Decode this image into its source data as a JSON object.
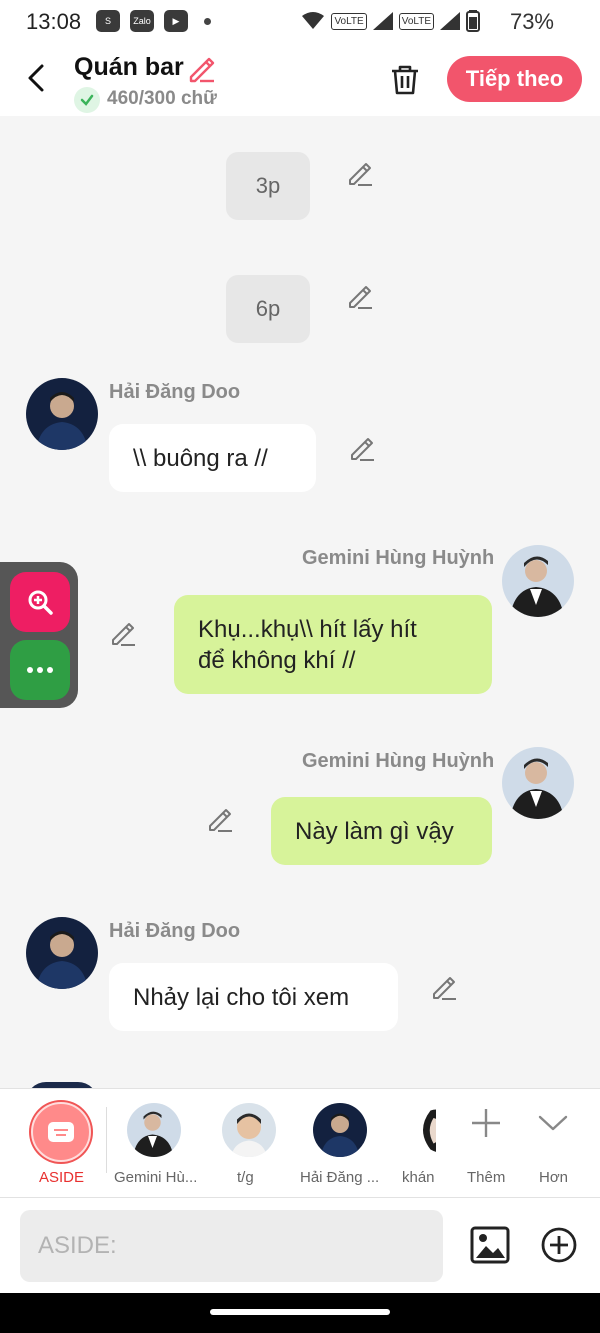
{
  "status_bar": {
    "time": "13:08",
    "battery": "73%",
    "volte_1": "VoLTE",
    "volte_2": "VoLTE",
    "app_icons": [
      "shopee-icon",
      "zalo-icon",
      "youtube-icon"
    ],
    "zalo_label": "Zalo"
  },
  "header": {
    "title": "Quán bar",
    "word_count": "460/300 chữ",
    "next_label": "Tiếp theo"
  },
  "messages": [
    {
      "type": "chip",
      "text": "3p"
    },
    {
      "type": "chip",
      "text": "6p"
    },
    {
      "type": "left",
      "sender": "Hải Đăng Doo",
      "text": "\\\\ buông ra //"
    },
    {
      "type": "right",
      "sender": "Gemini Hùng Huỳnh",
      "line1": "Khụ...khụ\\\\ hít lấy hít",
      "line2": "để không khí //"
    },
    {
      "type": "right",
      "sender": "Gemini Hùng Huỳnh",
      "text": "Này làm gì vậy"
    },
    {
      "type": "left",
      "sender": "Hải Đăng Doo",
      "text": "Nhảy lại cho tôi xem"
    }
  ],
  "character_bar": {
    "aside_label": "ASIDE",
    "characters": [
      {
        "label": "Gemini Hù..."
      },
      {
        "label": "t/g"
      },
      {
        "label": "Hải Đăng ..."
      },
      {
        "label": "khán"
      }
    ],
    "more_label": "Thêm",
    "less_label": "Hơn"
  },
  "input": {
    "placeholder": "ASIDE:",
    "value": ""
  },
  "colors": {
    "accent": "#f2556c",
    "green_bubble": "#d7f39a",
    "aside_red": "#e8302f",
    "zoom_btn": "#ee1e63",
    "more_btn": "#2f9e44"
  }
}
